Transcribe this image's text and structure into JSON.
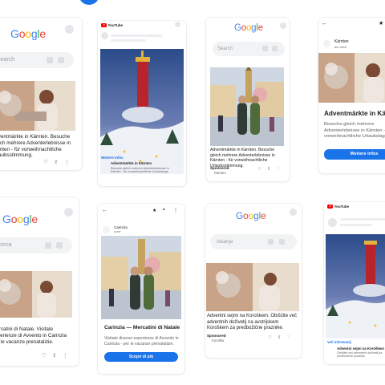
{
  "google_logo": [
    "G",
    "o",
    "o",
    "g",
    "l",
    "e"
  ],
  "search_placeholder": "Search",
  "cerca_placeholder": "Cerca",
  "iskanje_placeholder": "Iskanje",
  "youtube_label": "YouTube",
  "de_card": {
    "text": "Adventmärkte in Kärnten. Besuche gleich mehrere Adventerlebnisse in Kärnten - für vorweihnachtliche Urlaubsstimmung."
  },
  "yt_de": {
    "title": "Adventmärkte in Kärnten",
    "desc": "Besuche gleich mehrere Adventerlebnisse in Kärnten - für vorweihnachtliche Urlaubstage",
    "more_info": "Weitere Infos"
  },
  "search_de": {
    "text": "Adventmärkte in Kärnten. Besuche gleich mehrere Adventerlebnisse in Kärnten - für vorweihnachtliche Urlaubsstimmung.",
    "sponsored": "Sponsored",
    "advertiser": "Kärnten"
  },
  "landing_de": {
    "advertiser": "Kärnten",
    "sub": "am mich",
    "title": "Adventmärkte in Kärnten",
    "desc": "Besuche gleich mehrere Adventerlebnisse in Kärnten - für vorweihnachtliche Urlaubstage",
    "button": "Weitere Infos"
  },
  "it_card": {
    "text": "Mercatini di Natale. Visitate esperienze di Avvento in Carinzia per le vacanze prenatalizie."
  },
  "landing_it": {
    "advertiser": "Carinzia",
    "sub": "a me",
    "title": "Carinzia — Mercatini di Natale",
    "desc": "Visitate diverse esperienze di Avvento in Carinzia - per le vacanze prenatalizie.",
    "button": "Scopri di più"
  },
  "search_sl": {
    "text": "Adventni sejmi na Koroškem. Obiščite več adventnih doživetij na avstrijskem Koroškem za predbožične praznike.",
    "sponsored": "Sponsored",
    "advertiser": "Koroška"
  },
  "yt_sl": {
    "more_info": "Več informacij",
    "title": "Adventni sejmi na Koroškem",
    "desc": "Obiščite več adventnih doživetij za predbožične praznike"
  },
  "colors": {
    "blue": "#1a73e8",
    "youtube_red": "#ff0000"
  }
}
